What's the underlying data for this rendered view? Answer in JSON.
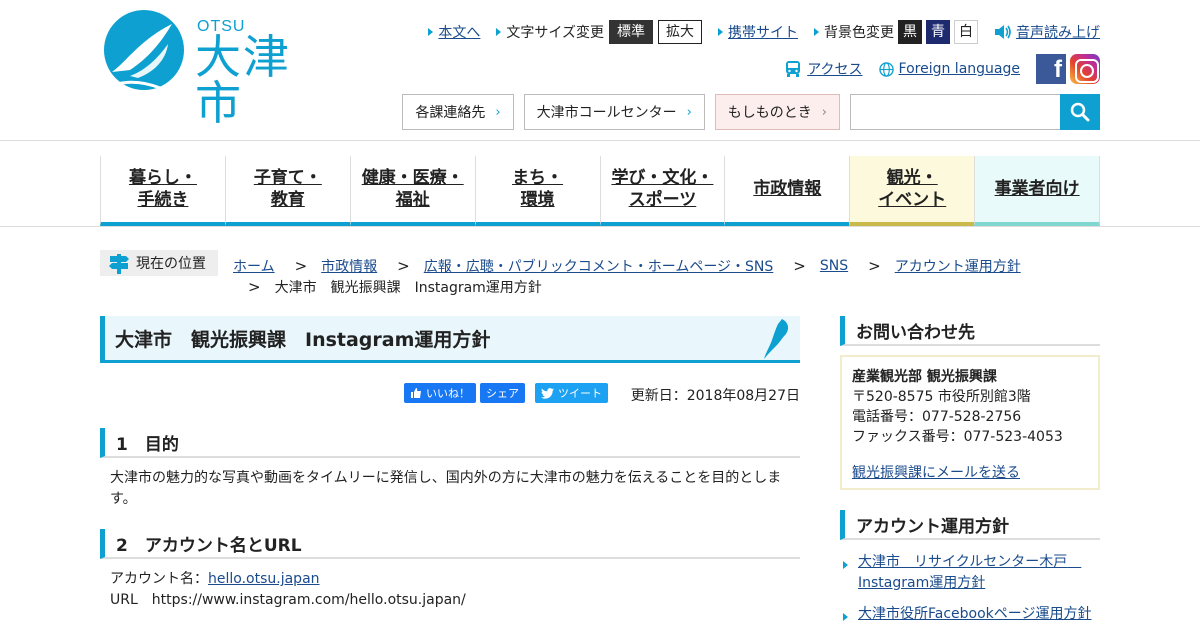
{
  "header": {
    "logo_small": "OTSU",
    "logo_name": "大津市",
    "util1": {
      "skip": "本文へ",
      "font_size_label": "文字サイズ変更",
      "size_normal": "標準",
      "size_large": "拡大",
      "mobile": "携帯サイト",
      "bg_label": "背景色変更",
      "bg_black": "黒",
      "bg_blue": "青",
      "bg_white": "白",
      "speech": "音声読み上げ"
    },
    "util2": {
      "access": "アクセス",
      "foreign": "Foreign language",
      "facebook_letter": "f"
    },
    "links": {
      "contacts": "各課連絡先",
      "call_center": "大津市コールセンター",
      "emergency": "もしものとき"
    },
    "search": {
      "placeholder": ""
    }
  },
  "nav": {
    "items": [
      "暮らし・\n手続き",
      "子育て・\n教育",
      "健康・医療・\n福祉",
      "まち・\n環境",
      "学び・文化・\nスポーツ",
      "市政情報",
      "観光・\nイベント",
      "事業者向け"
    ]
  },
  "breadcrumb": {
    "label": "現在の位置",
    "items": [
      "ホーム",
      "市政情報",
      "広報・広聴・パブリックコメント・ホームページ・SNS",
      "SNS",
      "アカウント運用方針"
    ],
    "current": "大津市　観光振興課　Instagram運用方針",
    "separator": ">"
  },
  "main": {
    "title": "大津市　観光振興課　Instagram運用方針",
    "share": {
      "like": "いいね！",
      "share": "シェア",
      "tweet": "ツイート"
    },
    "updated": "更新日：2018年08月27日",
    "section1": {
      "heading": "1　目的",
      "text": "大津市の魅力的な写真や動画をタイムリーに発信し、国内外の方に大津市の魅力を伝えることを目的とします。"
    },
    "section2": {
      "heading": "2　アカウント名とURL",
      "account_label": "アカウント名：",
      "account_name": "hello.otsu.japan",
      "url_label": "URL",
      "url_value": "https://www.instagram.com/hello.otsu.japan/"
    }
  },
  "sidebar": {
    "contact": {
      "heading": "お問い合わせ先",
      "dept": "産業観光部 観光振興課",
      "address": "〒520-8575 市役所別館3階",
      "tel": "電話番号：077-528-2756",
      "fax": "ファックス番号：077-523-4053",
      "mail": "観光振興課にメールを送る"
    },
    "policy": {
      "heading": "アカウント運用方針",
      "items": [
        "大津市　リサイクルセンター木戸　Instagram運用方針",
        "大津市役所Facebookページ運用方針"
      ]
    }
  },
  "colors": {
    "accent": "#0da0d0",
    "kanko_bg": "#fdf9dc",
    "jigyo_bg": "#e8fbfa",
    "link": "#1a4b8c"
  }
}
